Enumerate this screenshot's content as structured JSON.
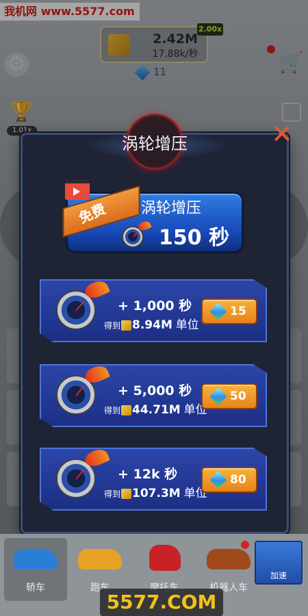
{
  "watermark_top": "我机网 www.5577.com",
  "watermark_bottom": "5577.COM",
  "hud": {
    "coins": "2.42M",
    "coin_rate": "17.88k/秒",
    "multiplier": "2.00x",
    "gems": "11",
    "trophy_multiplier": "1.01x"
  },
  "modal": {
    "title": "涡轮增压",
    "close_icon": "close-icon",
    "free_offer": {
      "ribbon": "免费",
      "title": "涡轮增压",
      "duration": "150 秒",
      "icon": "video-clapper-icon"
    },
    "options": [
      {
        "time": "+ 1,000 秒",
        "reward_prefix": "得到",
        "reward_value": "8.94M",
        "reward_unit": "单位",
        "price": "15"
      },
      {
        "time": "+ 5,000 秒",
        "reward_prefix": "得到",
        "reward_value": "44.71M",
        "reward_unit": "单位",
        "price": "50"
      },
      {
        "time": "+ 12k 秒",
        "reward_prefix": "得到",
        "reward_value": "107.3M",
        "reward_unit": "单位",
        "price": "80"
      }
    ]
  },
  "bottom_nav": {
    "tabs": [
      {
        "label": "轿车",
        "active": true,
        "color": "#2b7ed6"
      },
      {
        "label": "跑车",
        "active": false,
        "color": "#e7a226"
      },
      {
        "label": "摩托车",
        "active": false,
        "color": "#c92226"
      },
      {
        "label": "机器人车",
        "active": false,
        "color": "#a04a1c"
      }
    ],
    "boost_label": "加速"
  },
  "colors": {
    "modal_bg": "#1e2433",
    "card_blue": "#2c45a8",
    "buy_orange": "#f39a2a",
    "close_orange": "#e65a30"
  }
}
